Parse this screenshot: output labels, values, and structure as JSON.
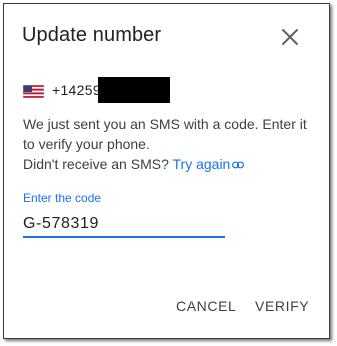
{
  "dialog": {
    "title": "Update number",
    "close_icon": "close-icon"
  },
  "phone": {
    "flag_icon": "us-flag-icon",
    "number_prefix": "+14259"
  },
  "message": {
    "line1": "We just sent you an SMS with a code. Enter it",
    "line2": "to verify your phone.",
    "line3_prefix": "Didn't receive an SMS?",
    "try_again_label": "Try again",
    "link_icon": "link-icon"
  },
  "code_field": {
    "label": "Enter the code",
    "value": "G-578319"
  },
  "actions": {
    "cancel_label": "CANCEL",
    "verify_label": "VERIFY"
  },
  "colors": {
    "accent": "#1a73e8",
    "text_primary": "#202124",
    "text_secondary": "#3c4043"
  }
}
